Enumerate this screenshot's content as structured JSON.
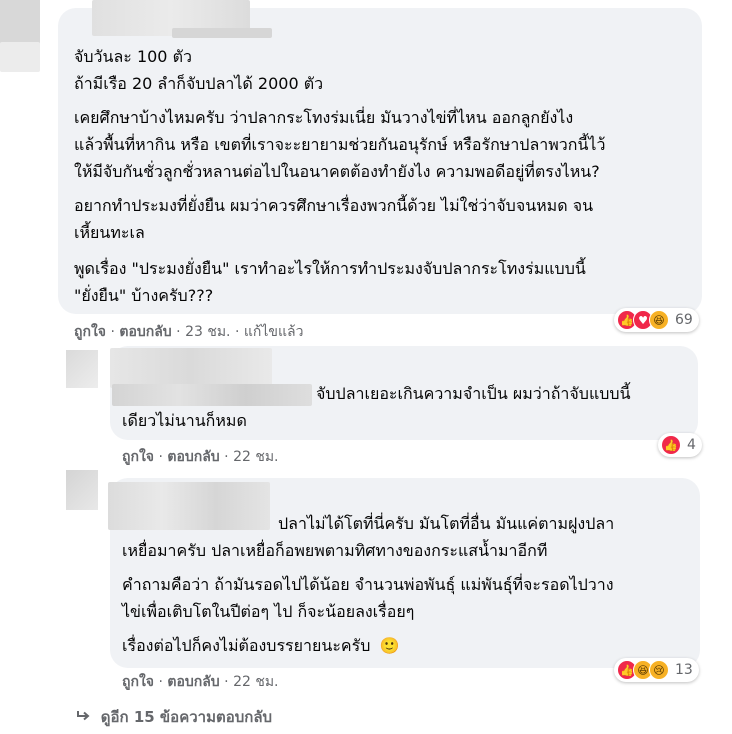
{
  "comments": [
    {
      "lines": [
        "จับวันละ 100 ตัว",
        "ถ้ามีเรือ 20 ลำก็จับปลาได้ 2000 ตัว",
        "เคยศึกษาบ้างไหมครับ ว่าปลากระโทงร่มเนี่ย มันวางไข่ที่ไหน ออกลูกยังไง",
        "แล้วพื้นที่หากิน หรือ เขตที่เราจะะยายามช่วยกันอนุรักษ์ หรือรักษาปลาพวกนี้ไว้",
        "ให้มีจับกันชั่วลูกชั่วหลานต่อไปในอนาคตต้องทำยังไง ความพอดีอยู่ที่ตรงไหน?",
        "อยากทำประมงที่ยั่งยืน ผมว่าควรศึกษาเรื่องพวกนี้ด้วย ไม่ใช่ว่าจับจนหมด จน",
        "เหี้ยนทะเล",
        "พูดเรื่อง \"ประมงยั่งยืน\" เราทำอะไรให้การทำประมงจับปลากระโทงร่มแบบนี้",
        "\"ยั่งยืน\" บ้างครับ???"
      ],
      "like": "ถูกใจ",
      "reply": "ตอบกลับ",
      "time": "23 ชม.",
      "edited": "แก้ไขแล้ว",
      "reaction_count": "69"
    },
    {
      "lines": [
        "จับปลาเยอะเกินความจำเป็น ผมว่าถ้าจับแบบนี้",
        "เดียวไม่นานก็หมด"
      ],
      "like": "ถูกใจ",
      "reply": "ตอบกลับ",
      "time": "22 ชม.",
      "reaction_count": "4"
    },
    {
      "lines": [
        "ปลาไม่ได้โตที่นี่ครับ มันโตที่อื่น มันแค่ตามฝูงปลา",
        "เหยื่อมาครับ ปลาเหยื่อก็อพยพตามทิศทางของกระแสน้ำมาอีกที",
        "คำถามคือว่า ถ้ามันรอดไปได้น้อย จำนวนพ่อพันธุ์ แม่พันธุ์ที่จะรอดไปวาง",
        "ไข่เพื่อเติบโตในปีต่อๆ ไป ก็จะน้อยลงเรื่อยๆ",
        "เรื่องต่อไปก็คงไม่ต้องบรรยายนะครับ"
      ],
      "emoji": "🙂",
      "like": "ถูกใจ",
      "reply": "ตอบกลับ",
      "time": "22 ชม.",
      "reaction_count": "13"
    }
  ],
  "more_replies": "ดูอีก 15 ข้อความตอบกลับ",
  "colors": {
    "bubble": "#f0f2f5",
    "meta": "#65676b",
    "like": "#f0284a",
    "haha": "#f7b125"
  }
}
